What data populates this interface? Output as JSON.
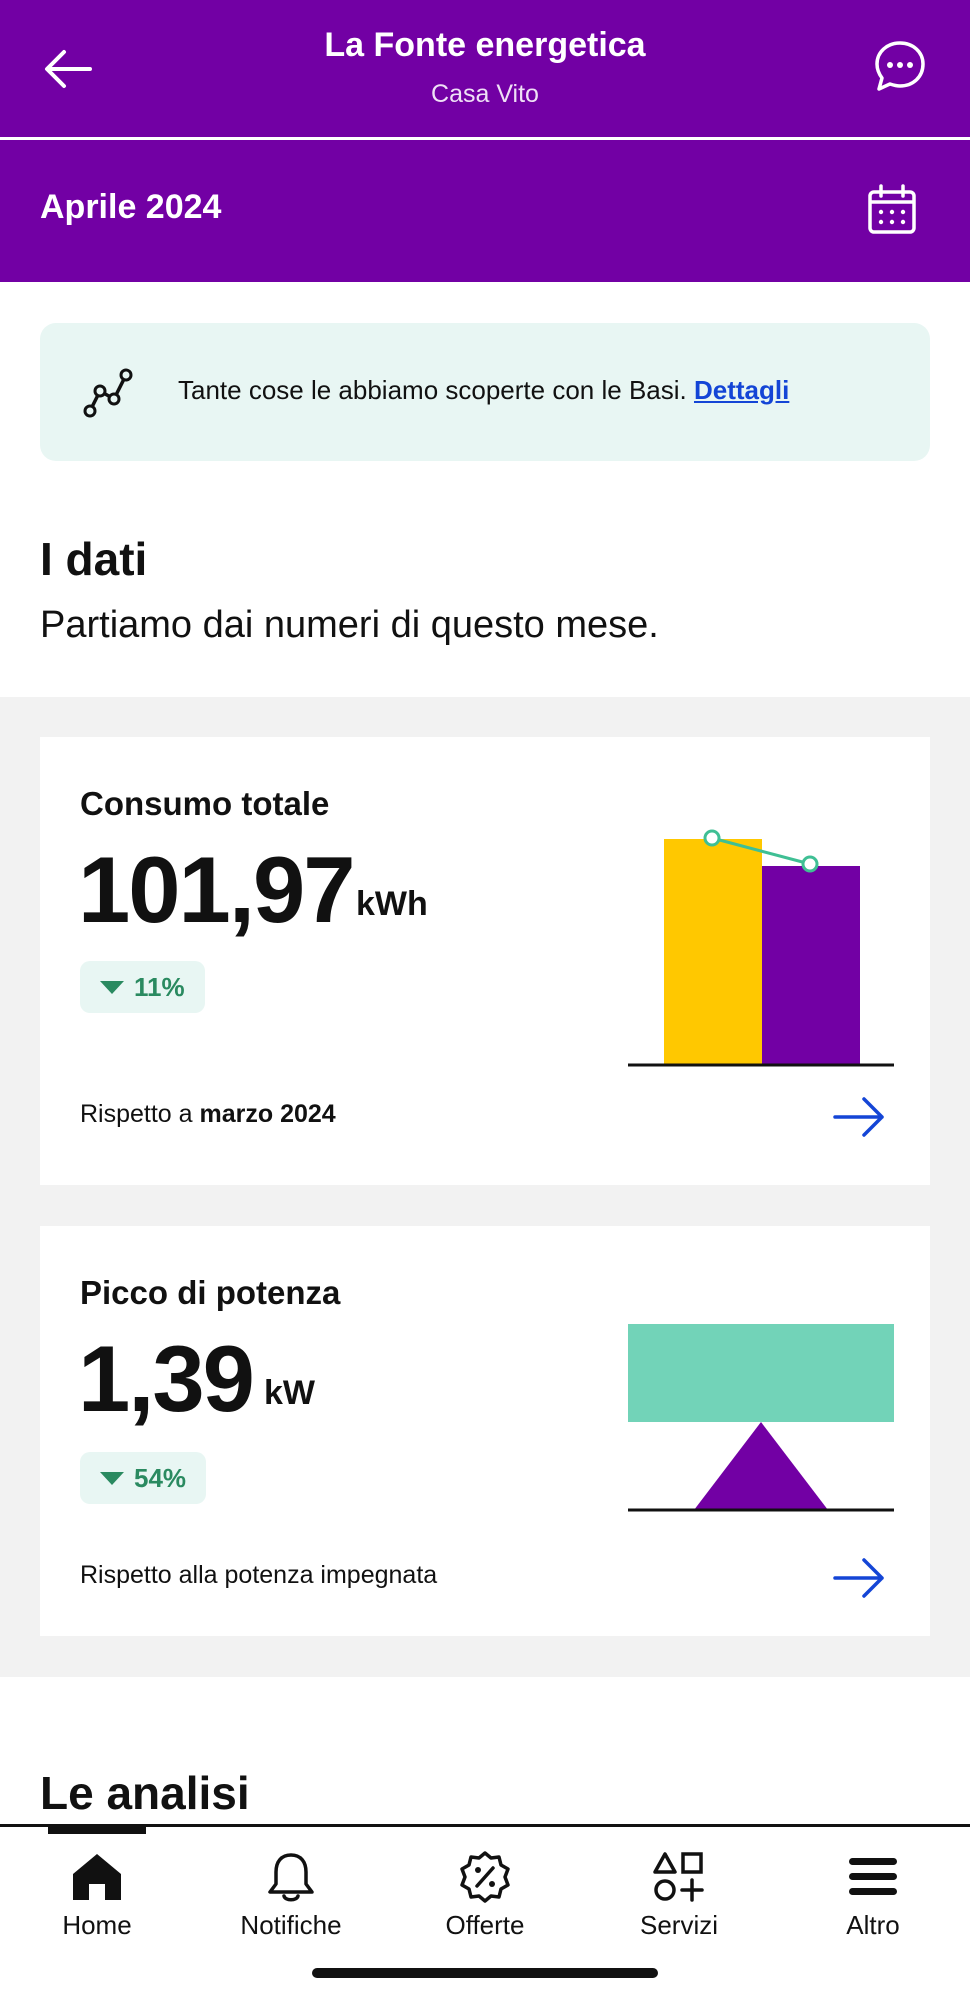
{
  "header": {
    "title": "La Fonte energetica",
    "subtitle": "Casa Vito"
  },
  "month": {
    "label": "Aprile 2024"
  },
  "banner": {
    "text": "Tante cose le abbiamo scoperte con le Basi.",
    "link": "Dettagli"
  },
  "section": {
    "title": "I dati",
    "subtitle": "Partiamo dai numeri di questo mese."
  },
  "cards": [
    {
      "label": "Consumo totale",
      "value": "101,97",
      "unit": "kWh",
      "change": "11%",
      "footer_prefix": "Rispetto a",
      "footer_bold": "marzo 2024"
    },
    {
      "label": "Picco di potenza",
      "value": "1,39",
      "unit": "kW",
      "change": "54%",
      "footer_prefix": "Rispetto alla potenza impegnata",
      "footer_bold": ""
    }
  ],
  "analisi": {
    "title": "Le analisi"
  },
  "tabs": [
    {
      "label": "Home",
      "icon": "home-icon"
    },
    {
      "label": "Notifiche",
      "icon": "bell-icon"
    },
    {
      "label": "Offerte",
      "icon": "discount-icon"
    },
    {
      "label": "Servizi",
      "icon": "shapes-icon"
    },
    {
      "label": "Altro",
      "icon": "menu-icon"
    }
  ],
  "colors": {
    "brand": "#7200a4",
    "accent_yellow": "#ffc800",
    "accent_green": "#72d3b8",
    "link": "#1445d6"
  }
}
